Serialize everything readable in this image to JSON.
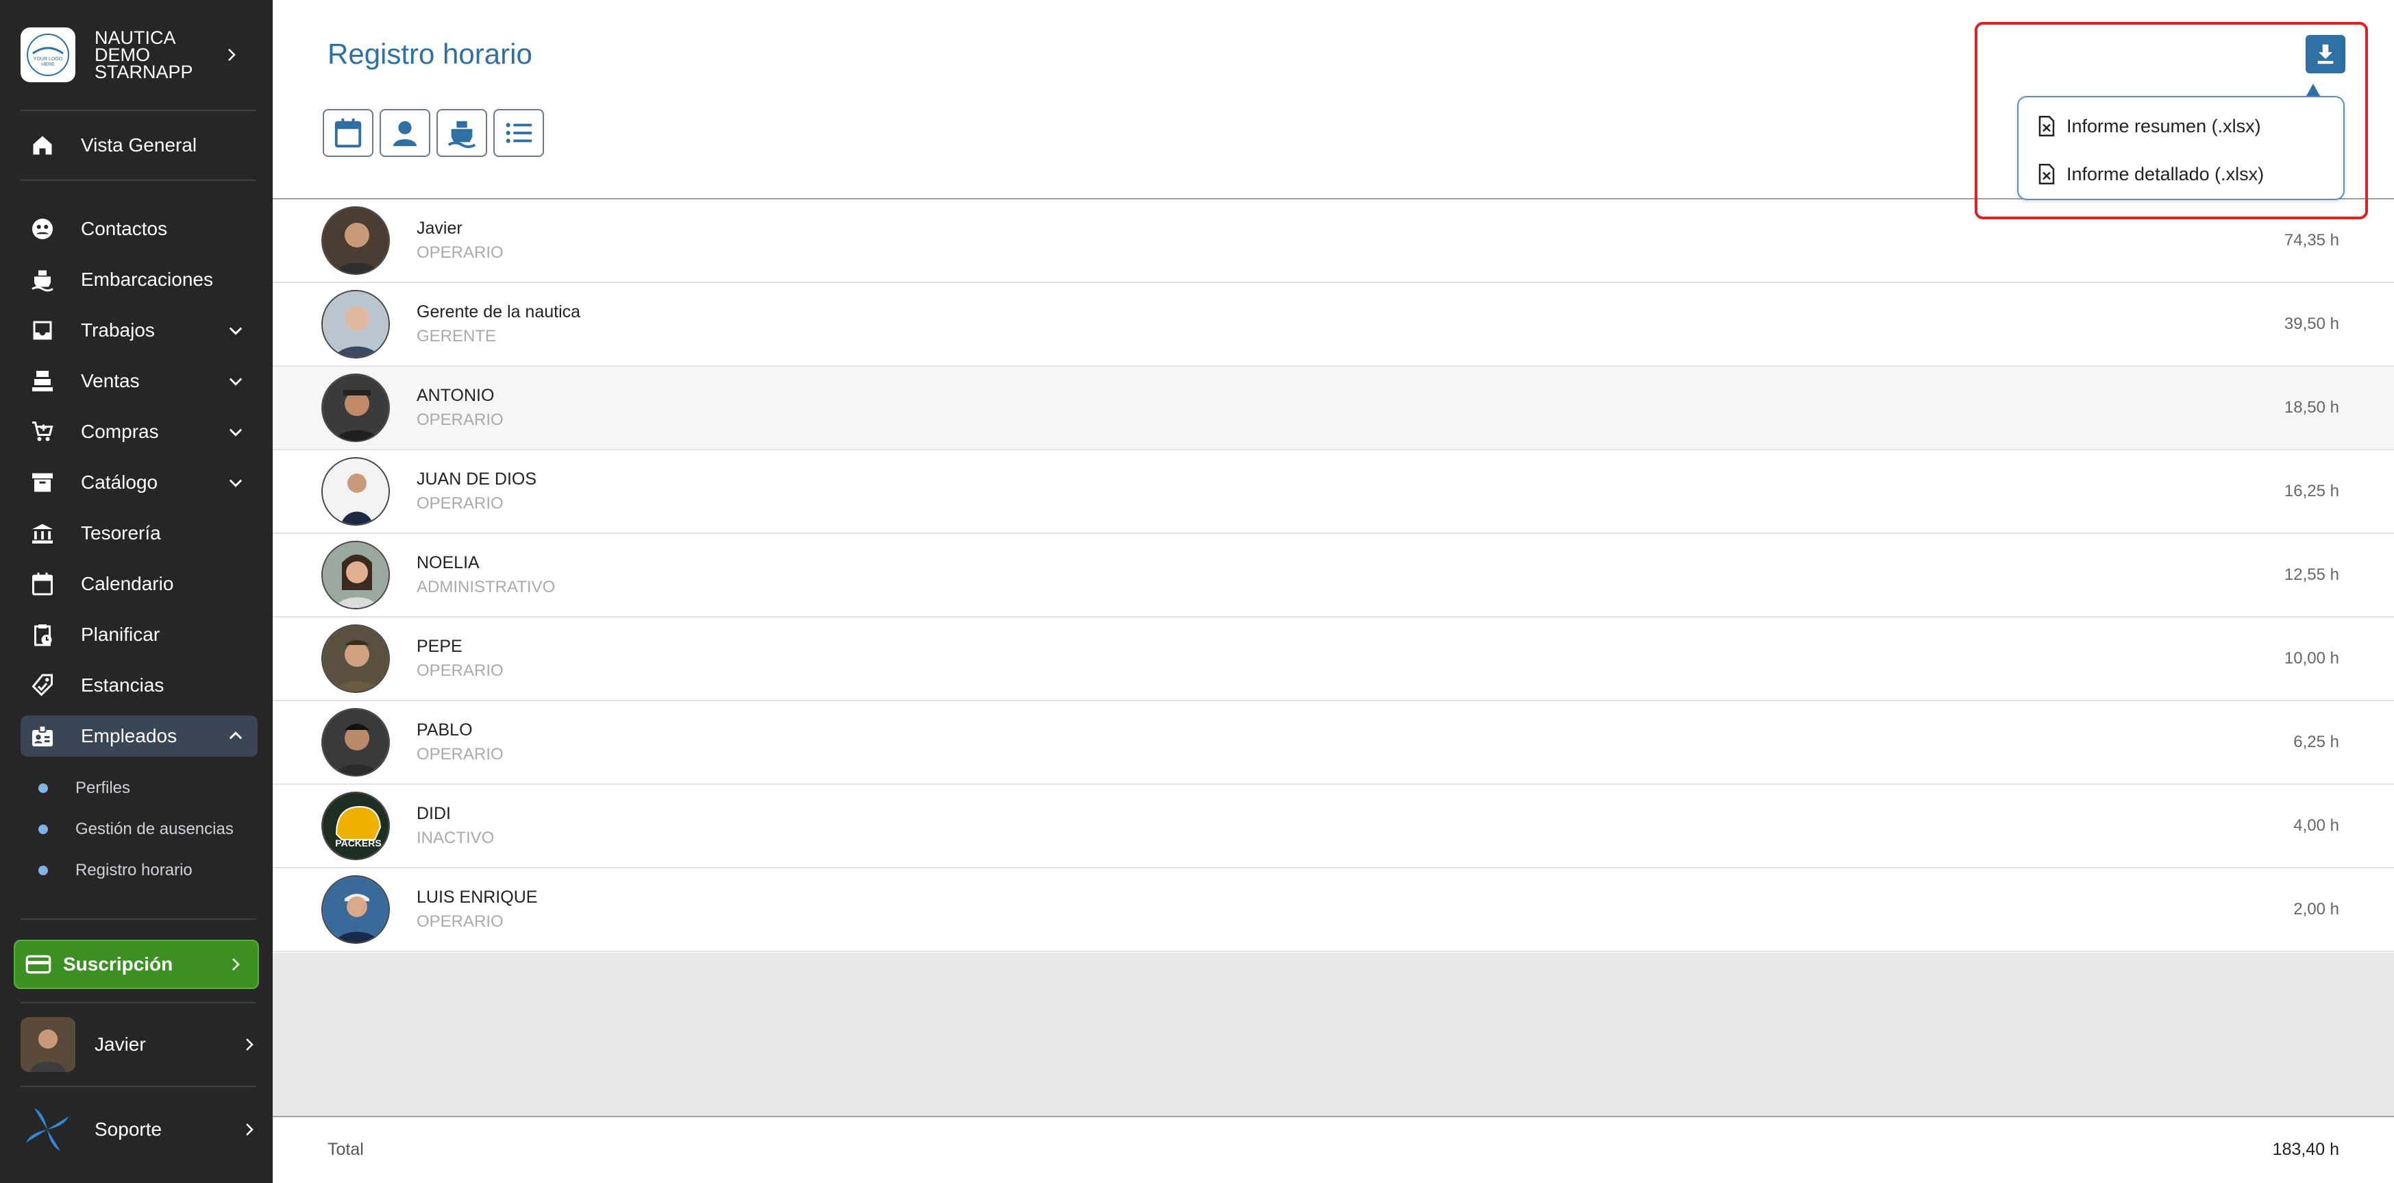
{
  "sidebar": {
    "brand": {
      "line1": "NAUTICA",
      "line2": "DEMO",
      "line3": "STARNAPP",
      "logo_text_1": "YOUR LOGO",
      "logo_text_2": "HERE"
    },
    "nav": [
      {
        "label": "Vista General",
        "icon": "home-icon"
      },
      {
        "label": "Contactos",
        "icon": "contacts-icon"
      },
      {
        "label": "Embarcaciones",
        "icon": "boat-icon"
      },
      {
        "label": "Trabajos",
        "icon": "inbox-icon"
      },
      {
        "label": "Ventas",
        "icon": "register-icon"
      },
      {
        "label": "Compras",
        "icon": "cart-icon"
      },
      {
        "label": "Catálogo",
        "icon": "archive-icon"
      },
      {
        "label": "Tesorería",
        "icon": "bank-icon"
      },
      {
        "label": "Calendario",
        "icon": "calendar-icon"
      },
      {
        "label": "Planificar",
        "icon": "clipboard-clock-icon"
      },
      {
        "label": "Estancias",
        "icon": "tag-icon"
      },
      {
        "label": "Empleados",
        "icon": "badge-icon"
      }
    ],
    "sub": [
      {
        "label": "Perfiles"
      },
      {
        "label": "Gestión de ausencias"
      },
      {
        "label": "Registro horario"
      }
    ],
    "subscription": "Suscripción",
    "user": "Javier",
    "support": "Soporte"
  },
  "main": {
    "title": "Registro horario",
    "toolbar_icons": [
      "calendar-icon",
      "person-icon",
      "boat-icon",
      "list-icon"
    ],
    "dropdown": {
      "items": [
        {
          "label": "Informe resumen (.xlsx)"
        },
        {
          "label": "Informe detallado (.xlsx)"
        }
      ]
    },
    "rows": [
      {
        "name": "Javier",
        "role": "OPERARIO",
        "hours": "74,35 h"
      },
      {
        "name": "Gerente de la nautica",
        "role": "GERENTE",
        "hours": "39,50 h"
      },
      {
        "name": "ANTONIO",
        "role": "OPERARIO",
        "hours": "18,50 h"
      },
      {
        "name": "JUAN DE DIOS",
        "role": "OPERARIO",
        "hours": "16,25 h"
      },
      {
        "name": "NOELIA",
        "role": "ADMINISTRATIVO",
        "hours": "12,55 h"
      },
      {
        "name": "PEPE",
        "role": "OPERARIO",
        "hours": "10,00 h"
      },
      {
        "name": "PABLO",
        "role": "OPERARIO",
        "hours": "6,25 h"
      },
      {
        "name": "DIDI",
        "role": "INACTIVO",
        "hours": "4,00 h",
        "avatar_text": "PACKERS"
      },
      {
        "name": "LUIS ENRIQUE",
        "role": "OPERARIO",
        "hours": "2,00 h"
      }
    ],
    "total_label": "Total",
    "total_value": "183,40 h"
  },
  "colors": {
    "sidebar_bg": "#262626",
    "accent": "#2e6fa4",
    "subscription": "#3c8f23",
    "highlight": "#e02020"
  }
}
